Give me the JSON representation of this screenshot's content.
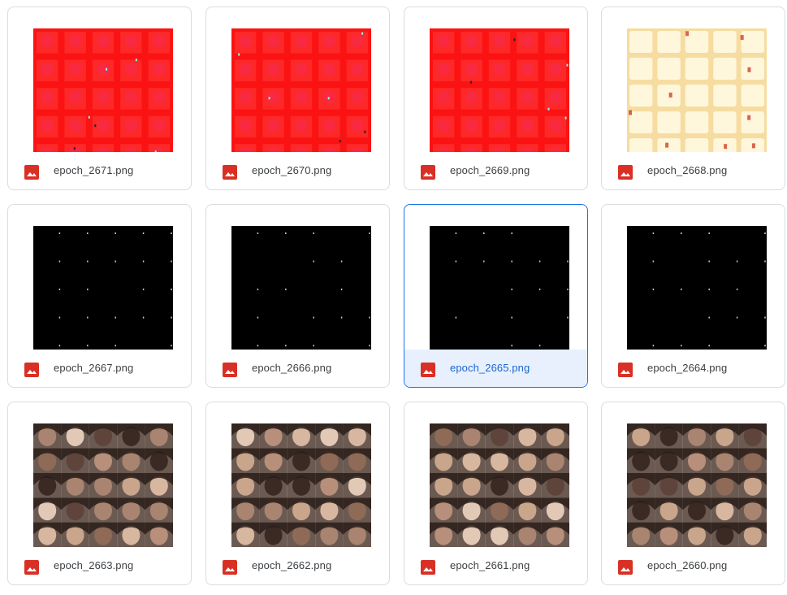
{
  "colors": {
    "border": "#dadce0",
    "selected_border": "#1a73e8",
    "selected_bg": "#e8f0fe",
    "selected_text": "#1967d2",
    "text": "#3c4043",
    "image_icon": "#d93025"
  },
  "files": [
    {
      "name": "epoch_2671.png",
      "thumb_style": "red-noise",
      "selected": false
    },
    {
      "name": "epoch_2670.png",
      "thumb_style": "red-noise",
      "selected": false
    },
    {
      "name": "epoch_2669.png",
      "thumb_style": "red-noise",
      "selected": false
    },
    {
      "name": "epoch_2668.png",
      "thumb_style": "yellow-tiles",
      "selected": false
    },
    {
      "name": "epoch_2667.png",
      "thumb_style": "black-dots",
      "selected": false
    },
    {
      "name": "epoch_2666.png",
      "thumb_style": "black-dots",
      "selected": false
    },
    {
      "name": "epoch_2665.png",
      "thumb_style": "black-dots",
      "selected": true
    },
    {
      "name": "epoch_2664.png",
      "thumb_style": "black-dots",
      "selected": false
    },
    {
      "name": "epoch_2663.png",
      "thumb_style": "face-grid",
      "selected": false
    },
    {
      "name": "epoch_2662.png",
      "thumb_style": "face-grid",
      "selected": false
    },
    {
      "name": "epoch_2661.png",
      "thumb_style": "face-grid",
      "selected": false
    },
    {
      "name": "epoch_2660.png",
      "thumb_style": "face-grid",
      "selected": false
    }
  ],
  "icons": {
    "file_type": "image-file-icon"
  }
}
